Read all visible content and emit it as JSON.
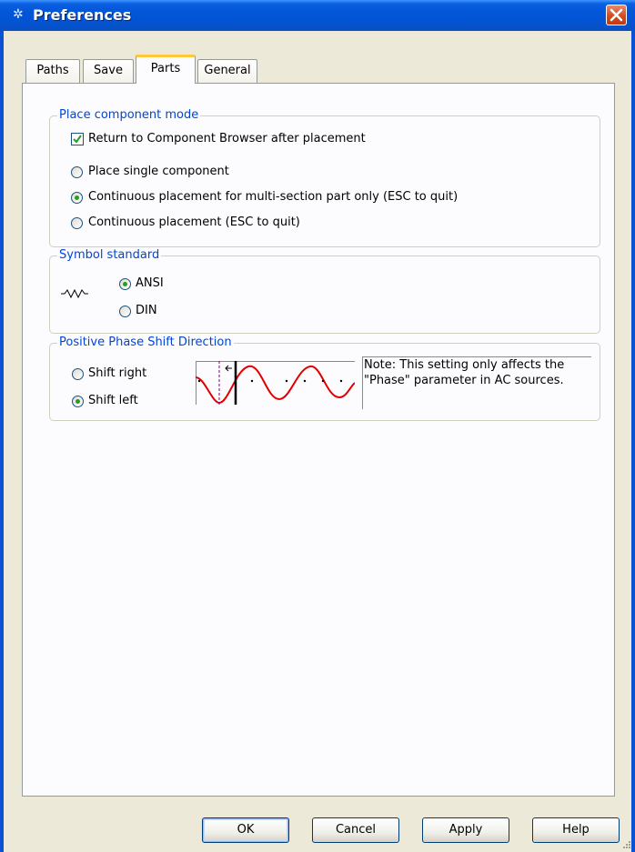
{
  "window": {
    "title": "Preferences"
  },
  "tabs": [
    {
      "label": "Paths"
    },
    {
      "label": "Save"
    },
    {
      "label": "Parts",
      "active": true
    },
    {
      "label": "General"
    }
  ],
  "place_mode": {
    "legend": "Place component mode",
    "return_browser": {
      "label": "Return to Component Browser after placement",
      "checked": true
    },
    "options": [
      {
        "label": "Place single component",
        "selected": false
      },
      {
        "label": "Continuous placement for multi-section part only (ESC to quit)",
        "selected": true
      },
      {
        "label": "Continuous placement (ESC to quit)",
        "selected": false
      }
    ]
  },
  "symbol_standard": {
    "legend": "Symbol standard",
    "options": [
      {
        "label": "ANSI",
        "selected": true
      },
      {
        "label": "DIN",
        "selected": false
      }
    ]
  },
  "phase_shift": {
    "legend": "Positive Phase Shift Direction",
    "options": [
      {
        "label": "Shift right",
        "selected": false
      },
      {
        "label": "Shift left",
        "selected": true
      }
    ],
    "note_line1": "Note: This setting only affects the",
    "note_line2": "\"Phase\" parameter in AC sources."
  },
  "buttons": {
    "ok": "OK",
    "cancel": "Cancel",
    "apply": "Apply",
    "help": "Help"
  },
  "colors": {
    "titlebar": "#0355d8",
    "legend_text": "#0046d5",
    "radio_dot": "#21a121",
    "wave": "#e00000"
  }
}
